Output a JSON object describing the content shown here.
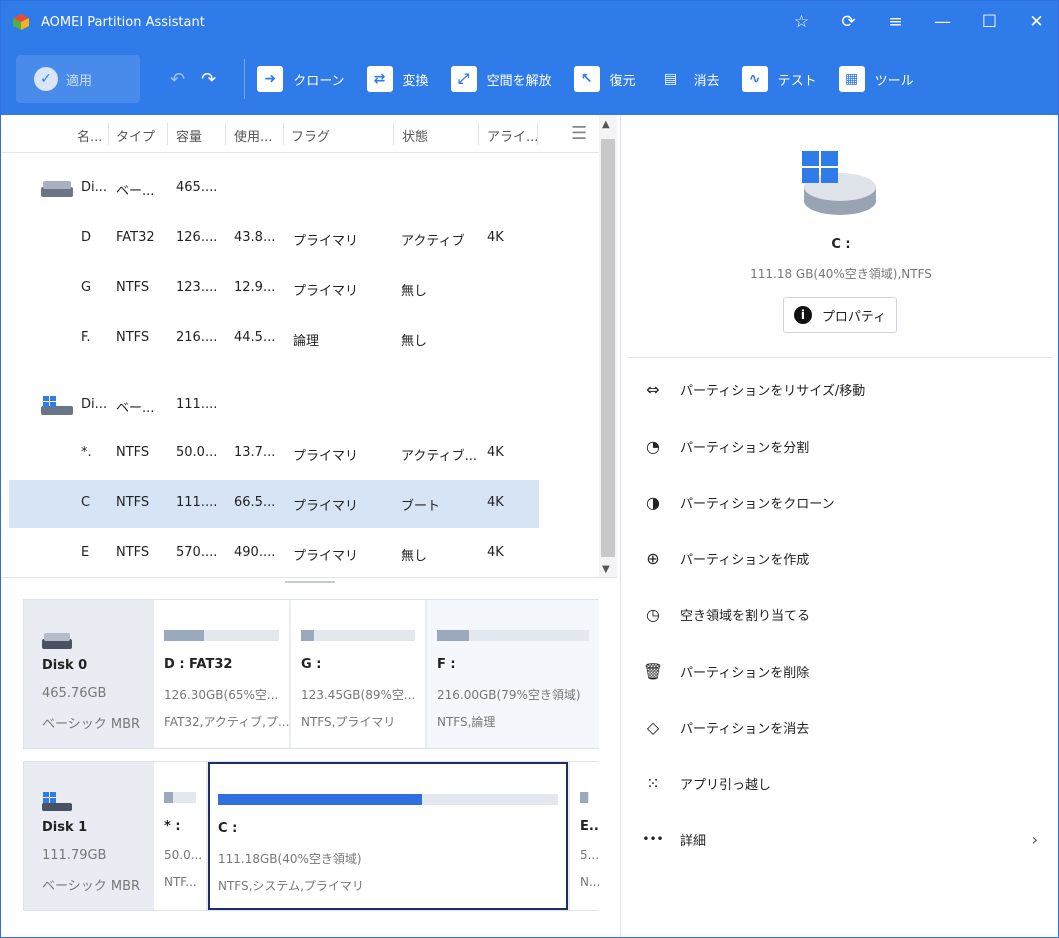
{
  "window": {
    "title": "AOMEI Partition Assistant"
  },
  "toolbar": {
    "apply": "適用",
    "items": [
      {
        "label": "クローン",
        "icon": "clone-icon"
      },
      {
        "label": "変換",
        "icon": "convert-icon"
      },
      {
        "label": "空間を解放",
        "icon": "free-space-icon"
      },
      {
        "label": "復元",
        "icon": "restore-icon"
      },
      {
        "label": "消去",
        "icon": "wipe-icon"
      },
      {
        "label": "テスト",
        "icon": "test-icon"
      },
      {
        "label": "ツール",
        "icon": "tools-icon"
      }
    ]
  },
  "table": {
    "headers": [
      "名...",
      "タイプ",
      "容量",
      "使用...",
      "フラグ",
      "状態",
      "アライ..."
    ],
    "rows": [
      {
        "kind": "disk",
        "name": "Di...",
        "type": "ベー...",
        "cap": "465....",
        "used": "",
        "flag": "",
        "state": "",
        "align": ""
      },
      {
        "kind": "part",
        "name": "D",
        "type": "FAT32",
        "cap": "126....",
        "used": "43.8...",
        "flag": "プライマリ",
        "state": "アクティブ",
        "align": "4K"
      },
      {
        "kind": "part",
        "name": "G",
        "type": "NTFS",
        "cap": "123....",
        "used": "12.9...",
        "flag": "プライマリ",
        "state": "無し",
        "align": ""
      },
      {
        "kind": "part",
        "name": "F.",
        "type": "NTFS",
        "cap": "216....",
        "used": "44.5...",
        "flag": "論理",
        "state": "無し",
        "align": ""
      },
      {
        "kind": "disk",
        "name": "Di...",
        "type": "ベー...",
        "cap": "111....",
        "used": "",
        "flag": "",
        "state": "",
        "align": ""
      },
      {
        "kind": "part",
        "name": "*.",
        "type": "NTFS",
        "cap": "50.0...",
        "used": "13.7...",
        "flag": "プライマリ",
        "state": "アクティブ...",
        "align": "4K"
      },
      {
        "kind": "part",
        "name": "C",
        "type": "NTFS",
        "cap": "111....",
        "used": "66.5...",
        "flag": "プライマリ",
        "state": "ブート",
        "align": "4K",
        "selected": true
      },
      {
        "kind": "part",
        "name": "E",
        "type": "NTFS",
        "cap": "570....",
        "used": "490....",
        "flag": "プライマリ",
        "state": "無し",
        "align": "4K"
      }
    ]
  },
  "disks": [
    {
      "name": "Disk 0",
      "size": "465.76GB",
      "kind": "ベーシック MBR",
      "parts": [
        {
          "name": "D : FAT32",
          "l1": "126.30GB(65%空...",
          "l2": "FAT32,アクティブ,プ...",
          "used_fraction": 0.35
        },
        {
          "name": "G :",
          "l1": "123.45GB(89%空...",
          "l2": "NTFS,プライマリ",
          "used_fraction": 0.11
        },
        {
          "name": "F :",
          "l1": "216.00GB(79%空き領域)",
          "l2": "NTFS,論理",
          "used_fraction": 0.21
        }
      ]
    },
    {
      "name": "Disk 1",
      "size": "111.79GB",
      "kind": "ベーシック MBR",
      "parts": [
        {
          "name": "* :",
          "l1": "50.0...",
          "l2": "NTF...",
          "used_fraction": 0.27
        },
        {
          "name": "C :",
          "l1": "111.18GB(40%空き領域)",
          "l2": "NTFS,システム,プライマリ",
          "used_fraction": 0.6,
          "selected": true
        },
        {
          "name": "E...",
          "l1": "5...",
          "l2": "N...",
          "used_fraction": 0.86
        }
      ]
    }
  ],
  "detail": {
    "name": "C :",
    "info": "111.18 GB(40%空き領域),NTFS",
    "properties": "プロパティ"
  },
  "actions": [
    {
      "label": "パーティションをリサイズ/移動",
      "icon": "resize-icon"
    },
    {
      "label": "パーティションを分割",
      "icon": "split-icon"
    },
    {
      "label": "パーティションをクローン",
      "icon": "clone-partition-icon"
    },
    {
      "label": "パーティションを作成",
      "icon": "create-partition-icon"
    },
    {
      "label": "空き領域を割り当てる",
      "icon": "allocate-space-icon"
    },
    {
      "label": "パーティションを削除",
      "icon": "trash-icon"
    },
    {
      "label": "パーティションを消去",
      "icon": "eraser-icon"
    },
    {
      "label": "アプリ引っ越し",
      "icon": "app-mover-icon"
    },
    {
      "label": "詳細",
      "icon": "more-icon"
    }
  ],
  "colors": {
    "accent": "#2f7be9",
    "selected_row": "#d6e4f5",
    "selected_border": "#1a2f66",
    "bar_fill": "#9aa9bd",
    "bar_fill_selected": "#2f6fe0"
  }
}
